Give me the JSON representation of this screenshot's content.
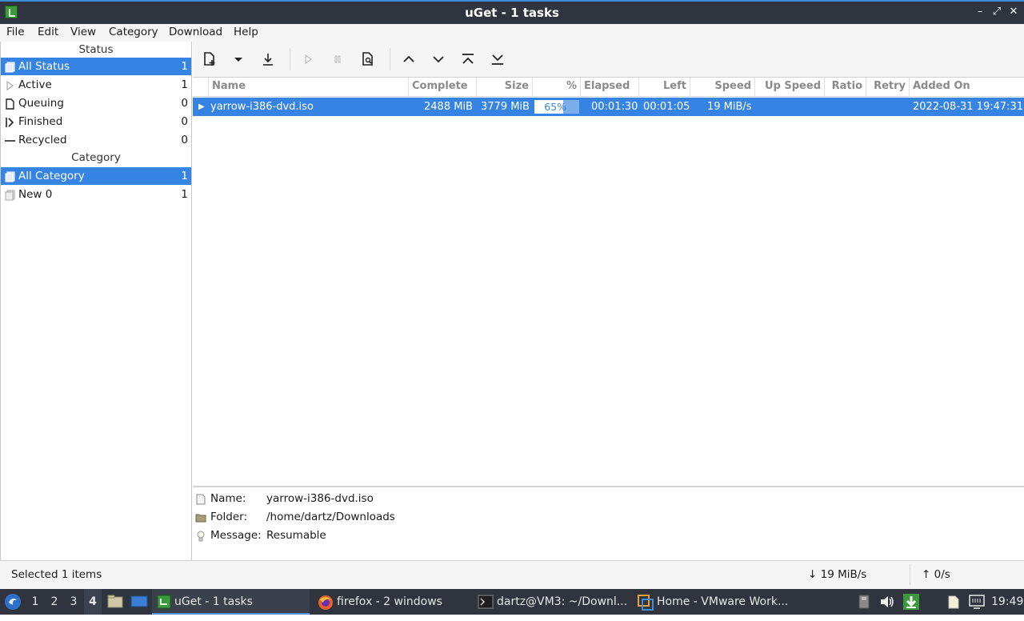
{
  "window": {
    "title": "uGet - 1 tasks"
  },
  "menu": [
    "File",
    "Edit",
    "View",
    "Category",
    "Download",
    "Help"
  ],
  "sidebar": {
    "status_header": "Status",
    "status_items": [
      {
        "label": "All Status",
        "count": "1",
        "icon": "all-status-icon"
      },
      {
        "label": "Active",
        "count": "1",
        "icon": "active-play-icon"
      },
      {
        "label": "Queuing",
        "count": "0",
        "icon": "queuing-doc-icon"
      },
      {
        "label": "Finished",
        "count": "0",
        "icon": "finished-icon"
      },
      {
        "label": "Recycled",
        "count": "0",
        "icon": "recycled-icon"
      }
    ],
    "category_header": "Category",
    "category_items": [
      {
        "label": "All Category",
        "count": "1",
        "icon": "all-category-icon"
      },
      {
        "label": "New 0",
        "count": "1",
        "icon": "category-icon"
      }
    ]
  },
  "columns": [
    "Name",
    "Complete",
    "Size",
    "%",
    "Elapsed",
    "Left",
    "Speed",
    "Up Speed",
    "Ratio",
    "Retry",
    "Added On"
  ],
  "tasks": [
    {
      "name": "yarrow-i386-dvd.iso",
      "complete": "2488 MiB",
      "size": "3779 MiB",
      "percent": "65%",
      "progress": 0.65,
      "elapsed": "00:01:30",
      "left": "00:01:05",
      "speed": "19 MiB/s",
      "up_speed": "",
      "ratio": "",
      "retry": "",
      "added_on": "2022-08-31 19:47:31"
    }
  ],
  "details": {
    "name_label": "Name:",
    "name_value": "yarrow-i386-dvd.iso",
    "folder_label": "Folder:",
    "folder_value": "/home/dartz/Downloads",
    "message_label": "Message:",
    "message_value": "Resumable"
  },
  "statusbar": {
    "selected": "Selected 1 items",
    "down_speed": "↓ 19 MiB/s",
    "up_speed": "↑ 0/s"
  },
  "taskbar": {
    "workspaces": [
      "1",
      "2",
      "3",
      "4"
    ],
    "active_workspace": "4",
    "tasks": [
      {
        "label": "uGet - 1 tasks",
        "icon": "uget-icon"
      },
      {
        "label": "firefox - 2 windows",
        "icon": "firefox-icon"
      },
      {
        "label": "dartz@VM3: ~/Downl...",
        "icon": "terminal-icon"
      },
      {
        "label": "Home - VMware Work...",
        "icon": "vmware-icon"
      }
    ],
    "clock": "19:49"
  },
  "colors": {
    "accent": "#3584e4",
    "titlebar": "#2f343f"
  }
}
